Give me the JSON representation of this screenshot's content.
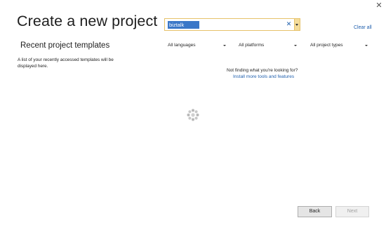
{
  "window": {
    "close_glyph": "✕"
  },
  "header": {
    "title": "Create a new project"
  },
  "recent": {
    "title": "Recent project templates",
    "empty_message": "A list of your recently accessed templates will be displayed here."
  },
  "search": {
    "value": "biztalk",
    "clear_glyph": "✕",
    "accent_color": "#e6c26a",
    "selection_color": "#3a77c8"
  },
  "clear_all_label": "Clear all",
  "filters": [
    {
      "label": "All languages"
    },
    {
      "label": "All platforms"
    },
    {
      "label": "All project types"
    }
  ],
  "not_finding": {
    "text": "Not finding what you're looking for?",
    "link": "Install more tools and features"
  },
  "loading": {
    "icon": "loading-spinner-icon"
  },
  "footer": {
    "back_label": "Back",
    "next_label": "Next",
    "next_enabled": false
  }
}
